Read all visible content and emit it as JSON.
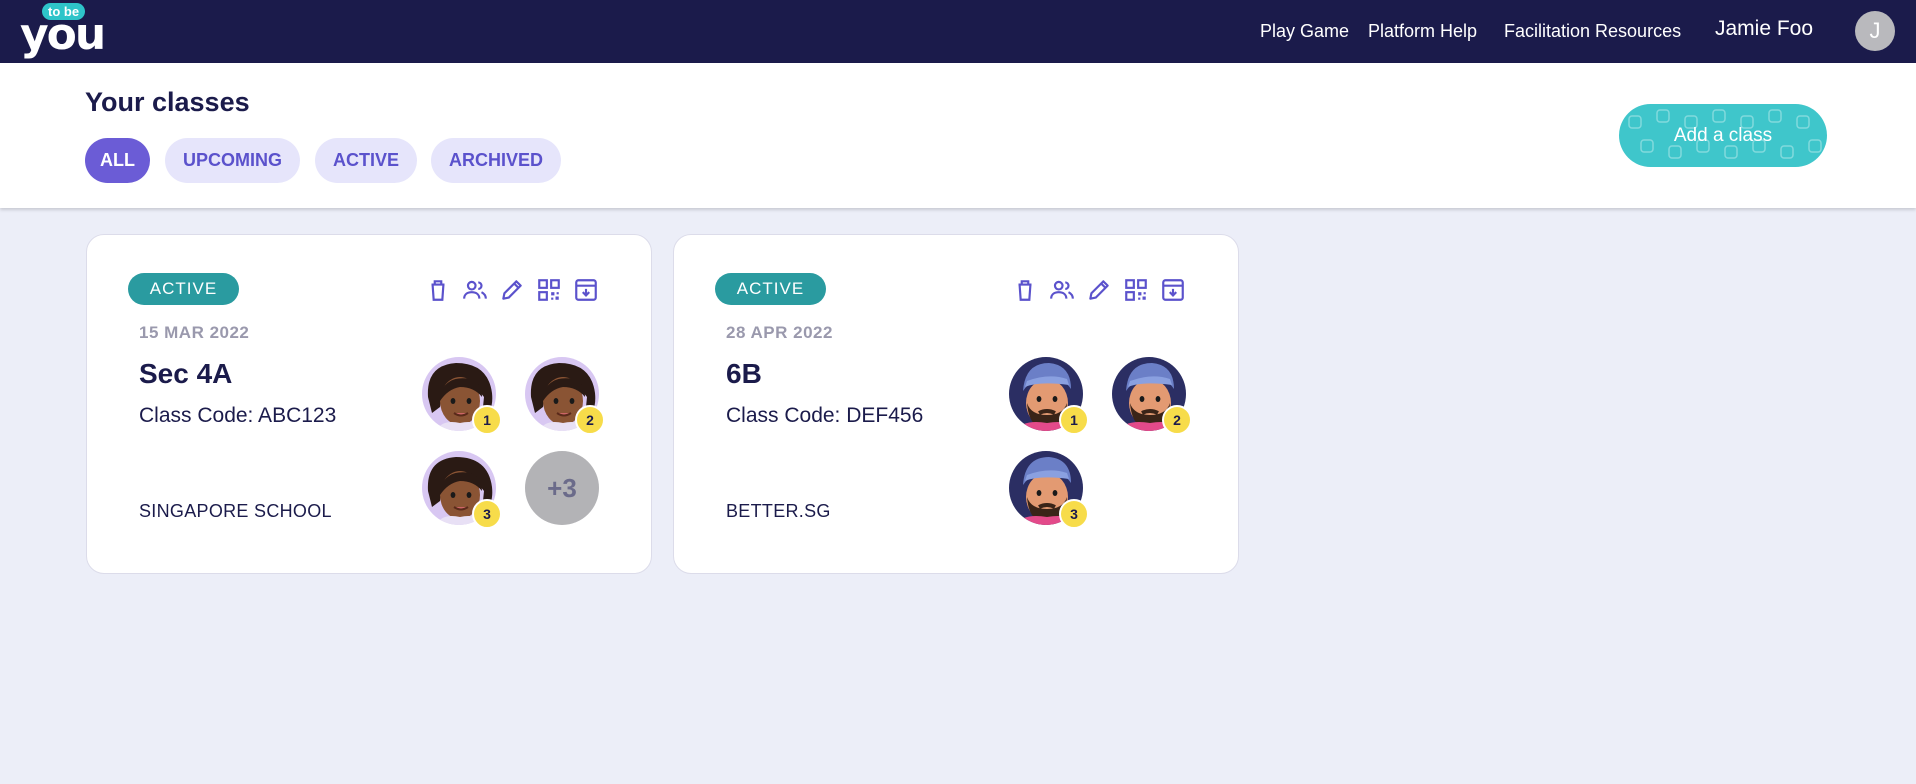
{
  "nav": {
    "logo_small": "to be",
    "logo_big": "you",
    "links": [
      "Play Game",
      "Platform Help",
      "Facilitation Resources"
    ],
    "user_name": "Jamie Foo",
    "user_initial": "J"
  },
  "header": {
    "title": "Your classes",
    "filters": [
      "ALL",
      "UPCOMING",
      "ACTIVE",
      "ARCHIVED"
    ],
    "selected_filter": "ALL",
    "add_button": "Add a class"
  },
  "colors": {
    "navy": "#1b1b4b",
    "accent": "#6b5cd6",
    "teal": "#2a9ba0",
    "button": "#3fc6cb",
    "badge": "#f7dc4a"
  },
  "action_icons": [
    "trash-icon",
    "users-icon",
    "pencil-icon",
    "qr-code-icon",
    "archive-icon"
  ],
  "classes": [
    {
      "status": "ACTIVE",
      "date": "15 MAR 2022",
      "name": "Sec 4A",
      "code": "Class Code: ABC123",
      "school": "SINGAPORE SCHOOL",
      "avatars": [
        "1",
        "2",
        "3"
      ],
      "more": "+3"
    },
    {
      "status": "ACTIVE",
      "date": "28 APR 2022",
      "name": "6B",
      "code": "Class Code: DEF456",
      "school": "BETTER.SG",
      "avatars": [
        "1",
        "2",
        "3"
      ]
    }
  ]
}
